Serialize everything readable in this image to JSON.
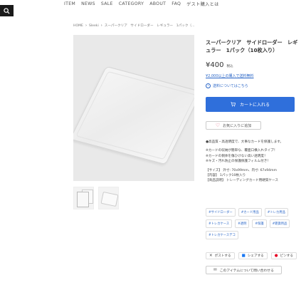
{
  "nav": {
    "items": [
      "ITEM",
      "NEWS",
      "SALE",
      "CATEGORY",
      "ABOUT",
      "FAQ",
      "ゲスト購入とは"
    ]
  },
  "breadcrumb": {
    "home": "HOME",
    "category": "Sleeki",
    "current": "スーパークリア　サイドローダー　レギュラー　1パック（…"
  },
  "product": {
    "title": "スーパークリア　サイドローダー　レギュラー　1パック（10枚入り）",
    "price": "¥400",
    "tax_label": "税込",
    "free_shipping": "¥2,000以上の購入で送料無料",
    "shipping_link": "送料についてはこちら",
    "cart_button": "カートに入れる",
    "favorite_button": "お気に入りに追加",
    "description": [
      "●高品質・高透明度で、大事なカードを保護します。",
      "",
      "※カードの収納が簡単な、覆面口横入れタイプ！",
      "※カードの側体を傷ひけない高い透明度！",
      "※キズ・汚れ防止の保護保護フィルム付き！",
      "",
      "【サイズ】 外寸: 70x99mm、内寸: 67x94mm",
      "【内容】 1パック10枚入り",
      "【商品説明】 トレーディングカード用硬質ケース"
    ],
    "tags": [
      "#サイドローダー",
      "#カード用品",
      "#トレカ用品",
      "#トレカケース",
      "#透明",
      "#保護",
      "#雑貨用品",
      "#トレカケースデコ"
    ],
    "share": {
      "post": "ポストする",
      "facebook": "シェアする",
      "pinterest": "ピンする"
    },
    "contact_button": "このアイテムについて問い合わせる"
  },
  "colors": {
    "accent": "#2f6fdb",
    "link": "#2a66c7",
    "heart": "#e05a7a"
  }
}
